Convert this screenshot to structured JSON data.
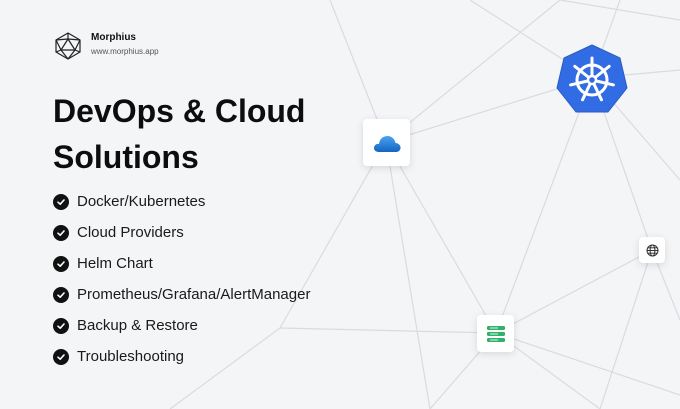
{
  "brand": {
    "name": "Morphius",
    "url": "www.morphius.app",
    "logo_icon": "polyhedron-icon"
  },
  "headline": {
    "line1": "DevOps & Cloud",
    "line2": "Solutions"
  },
  "features": [
    {
      "label": "Docker/Kubernetes",
      "icon": "check-circle-icon"
    },
    {
      "label": "Cloud Providers",
      "icon": "check-circle-icon"
    },
    {
      "label": "Helm Chart",
      "icon": "check-circle-icon"
    },
    {
      "label": "Prometheus/Grafana/AlertManager",
      "icon": "check-circle-icon"
    },
    {
      "label": "Backup & Restore",
      "icon": "check-circle-icon"
    },
    {
      "label": "Troubleshooting",
      "icon": "check-circle-icon"
    }
  ],
  "network_icons": {
    "cloud": "cloud-icon",
    "kubernetes": "kubernetes-helm-icon",
    "globe": "globe-icon",
    "server": "server-icon"
  },
  "colors": {
    "background": "#f4f5f7",
    "kubernetes_blue": "#326ce5",
    "cloud_blue": "#1e88e5",
    "server_green": "#2fb36b",
    "check_black": "#111111"
  }
}
